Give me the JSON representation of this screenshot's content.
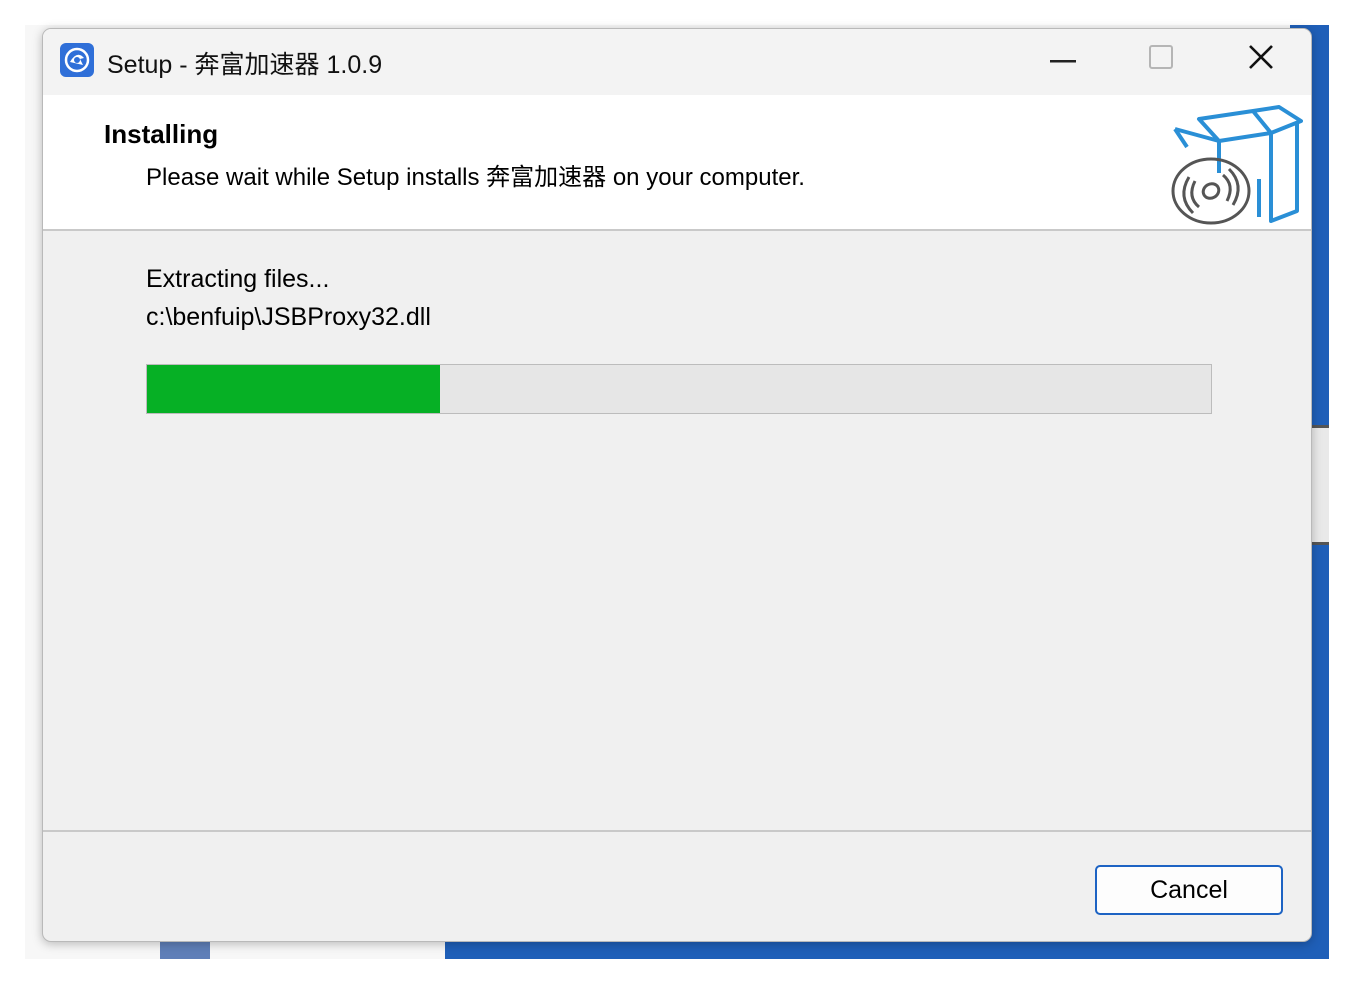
{
  "window": {
    "title": "Setup - 奔富加速器 1.0.9",
    "controls": {
      "minimize_icon": "minimize-icon",
      "maximize_icon": "maximize-icon",
      "close_icon": "close-icon"
    }
  },
  "header": {
    "title": "Installing",
    "subtitle": "Please wait while Setup installs 奔富加速器 on your computer.",
    "graphic_icon": "install-box-disc-icon"
  },
  "main": {
    "status": "Extracting files...",
    "current_file": "c:\\benfuip\\JSBProxy32.dll",
    "progress_fraction": 0.275
  },
  "footer": {
    "cancel_label": "Cancel"
  },
  "colors": {
    "progress_fill": "#06b025",
    "progress_track": "#e6e6e6",
    "button_border": "#1d63c3",
    "header_bg": "#ffffff",
    "window_bg": "#f0f0f0"
  }
}
